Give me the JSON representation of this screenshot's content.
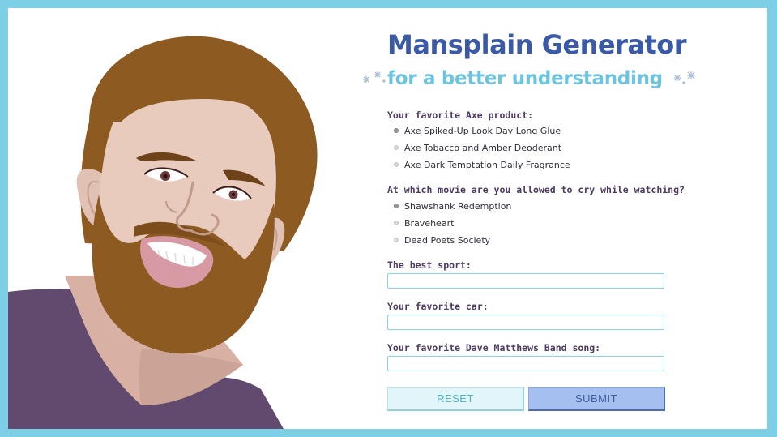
{
  "header": {
    "title": "Mansplain Generator",
    "subtitle": "for a better understanding"
  },
  "questions": {
    "axe": {
      "label": "Your favorite Axe product:",
      "options": [
        {
          "label": "Axe Spiked-Up Look Day Long Glue",
          "selected": true
        },
        {
          "label": "Axe Tobacco and Amber Deoderant",
          "selected": false
        },
        {
          "label": "Axe Dark Temptation Daily Fragrance",
          "selected": false
        }
      ]
    },
    "movie": {
      "label": "At which movie are you allowed to cry while watching?",
      "options": [
        {
          "label": "Shawshank Redemption",
          "selected": true
        },
        {
          "label": "Braveheart",
          "selected": false
        },
        {
          "label": "Dead Poets Society",
          "selected": false
        }
      ]
    },
    "sport": {
      "label": "The best sport:",
      "value": "",
      "placeholder": ""
    },
    "car": {
      "label": "Your favorite car:",
      "value": "",
      "placeholder": ""
    },
    "dmb_song": {
      "label": "Your favorite Dave Matthews Band song:",
      "value": "",
      "placeholder": ""
    }
  },
  "buttons": {
    "reset": "RESET",
    "submit": "SUBMIT"
  },
  "colors": {
    "frame": "#7dcfe6",
    "title": "#3a5aa8",
    "subtitle": "#6cc4e0",
    "label": "#4d3a60",
    "field_border": "#88d4e6",
    "reset_bg": "#e2f6fa",
    "submit_bg": "#a6bff1"
  },
  "illustration": {
    "name": "smiling-bearded-man-illustration"
  }
}
